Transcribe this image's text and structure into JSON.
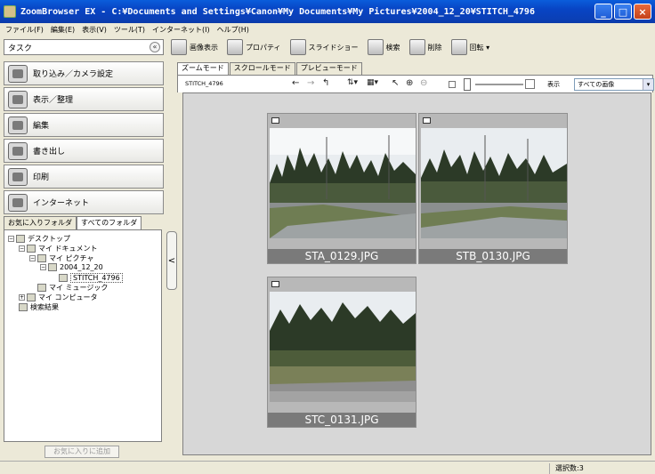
{
  "window": {
    "title": "ZoomBrowser EX  -  C:¥Documents and Settings¥Canon¥My Documents¥My Pictures¥2004_12_20¥STITCH_4796",
    "minimize": "_",
    "maximize": "□",
    "close": "×"
  },
  "menubar": [
    "ファイル(F)",
    "編集(E)",
    "表示(V)",
    "ツール(T)",
    "インターネット(I)",
    "ヘルプ(H)"
  ],
  "task_panel": {
    "header": "タスク",
    "collapse": "«",
    "buttons": [
      "取り込み／カメラ設定",
      "表示／整理",
      "編集",
      "書き出し",
      "印刷",
      "インターネット"
    ]
  },
  "folder_tabs": [
    "お気に入りフォルダ",
    "すべてのフォルダ"
  ],
  "tree": {
    "desktop": "デスクトップ",
    "my_documents": "マイ ドキュメント",
    "my_pictures": "マイ ピクチャ",
    "date_folder": "2004_12_20",
    "stitch": "STITCH_4796",
    "my_music": "マイ ミュージック",
    "my_computer": "マイ コンピュータ",
    "search_results": "検索結果"
  },
  "add_favorite": "お気に入りに追加",
  "splitter": "<",
  "toolbar": {
    "view_image": "画像表示",
    "properties": "プロパティ",
    "slideshow": "スライドショー",
    "search": "検索",
    "delete": "削除",
    "rotate": "回転 ▾"
  },
  "mode_tabs": [
    "ズームモード",
    "スクロールモード",
    "プレビューモード"
  ],
  "view": {
    "folder_name": "STITCH_4796",
    "show_label": "表示",
    "show_select": "すべての画像",
    "back": "←",
    "forward": "→",
    "up": "↰",
    "sort": "⇅▾",
    "layout": "▦▾",
    "pointer": "↖",
    "zoom_in": "⊕",
    "zoom_out": "⊖"
  },
  "thumbnails": [
    {
      "filename": "STA_0129.JPG"
    },
    {
      "filename": "STB_0130.JPG"
    },
    {
      "filename": "STC_0131.JPG"
    }
  ],
  "status": {
    "selected": "選択数:3"
  }
}
